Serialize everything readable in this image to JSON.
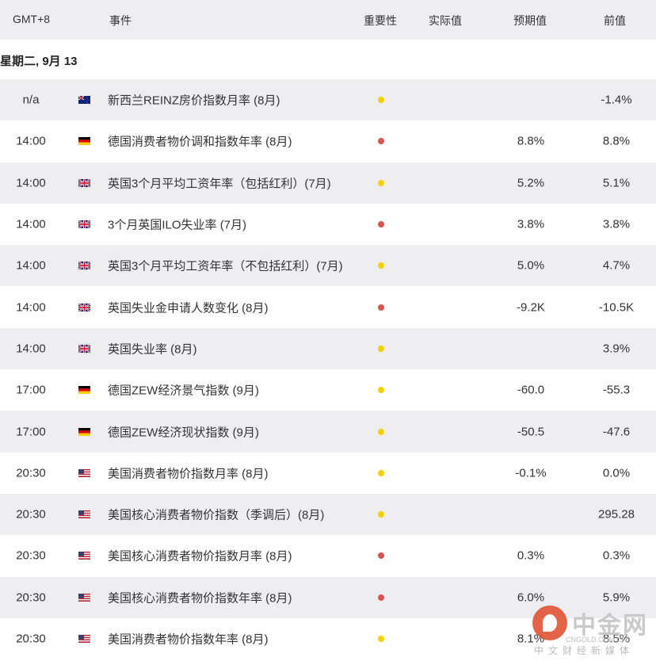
{
  "header": {
    "timezone": "GMT+8",
    "event": "事件",
    "importance": "重要性",
    "actual": "实际值",
    "forecast": "预期值",
    "previous": "前值"
  },
  "date_label": "星期二, 9月 13",
  "colors": {
    "high": "#d9534f",
    "medium": "#f5d000",
    "row_alt": "#eeeef0"
  },
  "events": [
    {
      "time": "n/a",
      "country": "NZ",
      "event": "新西兰REINZ房价指数月率 (8月)",
      "importance": "medium",
      "actual": "",
      "forecast": "",
      "previous": "-1.4%"
    },
    {
      "time": "14:00",
      "country": "DE",
      "event": "德国消费者物价调和指数年率 (8月)",
      "importance": "high",
      "actual": "",
      "forecast": "8.8%",
      "previous": "8.8%"
    },
    {
      "time": "14:00",
      "country": "GB",
      "event": "英国3个月平均工资年率（包括红利）(7月)",
      "importance": "medium",
      "actual": "",
      "forecast": "5.2%",
      "previous": "5.1%"
    },
    {
      "time": "14:00",
      "country": "GB",
      "event": "3个月英国ILO失业率 (7月)",
      "importance": "high",
      "actual": "",
      "forecast": "3.8%",
      "previous": "3.8%"
    },
    {
      "time": "14:00",
      "country": "GB",
      "event": "英国3个月平均工资年率（不包括红利）(7月)",
      "importance": "medium",
      "actual": "",
      "forecast": "5.0%",
      "previous": "4.7%"
    },
    {
      "time": "14:00",
      "country": "GB",
      "event": "英国失业金申请人数变化 (8月)",
      "importance": "high",
      "actual": "",
      "forecast": "-9.2K",
      "previous": "-10.5K"
    },
    {
      "time": "14:00",
      "country": "GB",
      "event": "英国失业率 (8月)",
      "importance": "medium",
      "actual": "",
      "forecast": "",
      "previous": "3.9%"
    },
    {
      "time": "17:00",
      "country": "DE",
      "event": "德国ZEW经济景气指数 (9月)",
      "importance": "medium",
      "actual": "",
      "forecast": "-60.0",
      "previous": "-55.3"
    },
    {
      "time": "17:00",
      "country": "DE",
      "event": "德国ZEW经济现状指数 (9月)",
      "importance": "medium",
      "actual": "",
      "forecast": "-50.5",
      "previous": "-47.6"
    },
    {
      "time": "20:30",
      "country": "US",
      "event": "美国消费者物价指数月率 (8月)",
      "importance": "medium",
      "actual": "",
      "forecast": "-0.1%",
      "previous": "0.0%"
    },
    {
      "time": "20:30",
      "country": "US",
      "event": "美国核心消费者物价指数（季调后）(8月)",
      "importance": "medium",
      "actual": "",
      "forecast": "",
      "previous": "295.28"
    },
    {
      "time": "20:30",
      "country": "US",
      "event": "美国核心消费者物价指数月率 (8月)",
      "importance": "high",
      "actual": "",
      "forecast": "0.3%",
      "previous": "0.3%"
    },
    {
      "time": "20:30",
      "country": "US",
      "event": "美国核心消费者物价指数年率 (8月)",
      "importance": "high",
      "actual": "",
      "forecast": "6.0%",
      "previous": "5.9%"
    },
    {
      "time": "20:30",
      "country": "US",
      "event": "美国消费者物价指数年率 (8月)",
      "importance": "medium",
      "actual": "",
      "forecast": "8.1%",
      "previous": "8.5%"
    }
  ],
  "watermark": {
    "name": "中金网",
    "domain": "CNGOLD.COM.CN",
    "subtitle": "中文财经新媒体"
  }
}
